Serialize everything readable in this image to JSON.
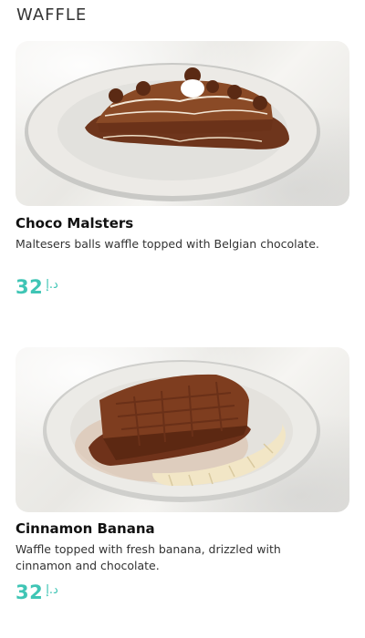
{
  "section": {
    "title": "WAFFLE"
  },
  "items": [
    {
      "name": "Choco Malsters",
      "description": "Maltesers balls waffle topped with Belgian chocolate.",
      "price": "32",
      "currency": "د.إ"
    },
    {
      "name": "Cinnamon Banana",
      "description": "Waffle topped with fresh banana, drizzled with cinnamon and chocolate.",
      "price": "32",
      "currency": "د.إ"
    }
  ],
  "colors": {
    "price": "#3fc5b5",
    "chocolate": "#7a3a1e"
  }
}
